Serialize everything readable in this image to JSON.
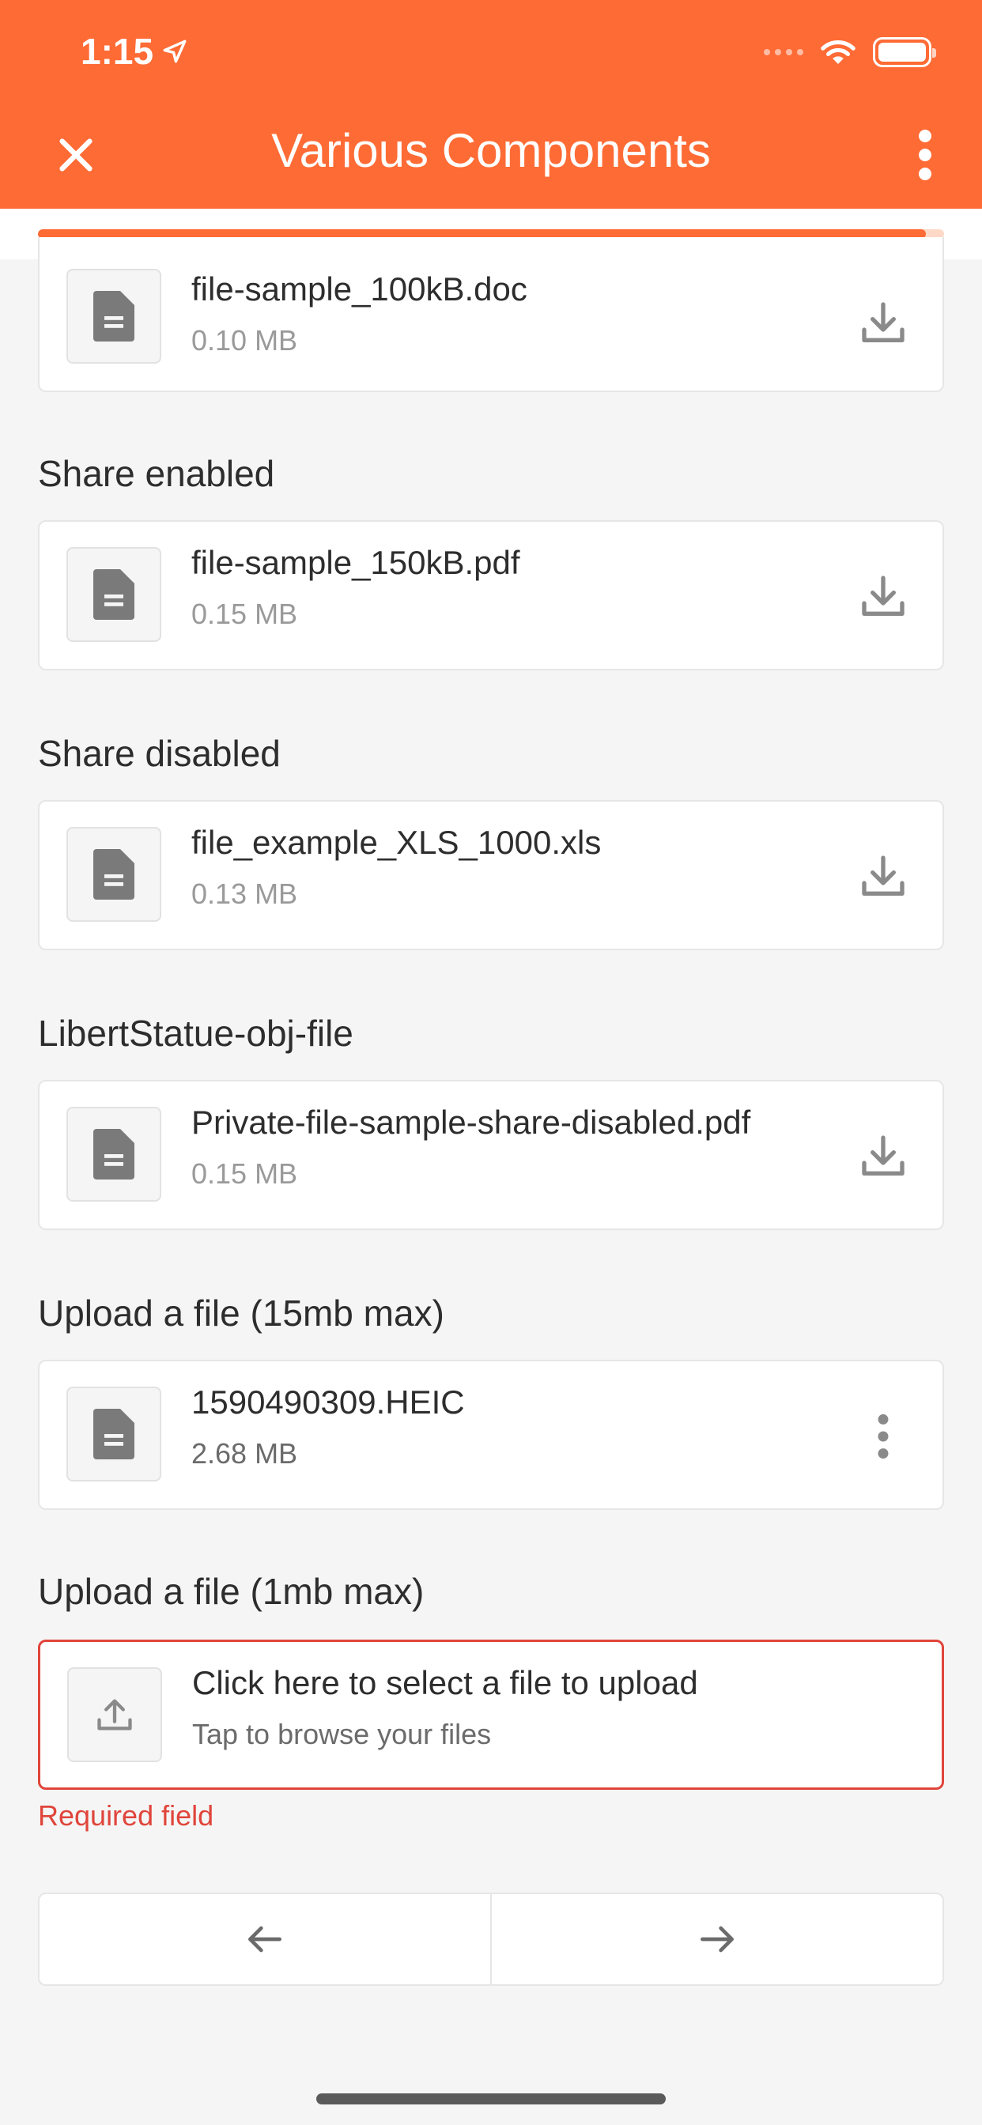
{
  "status_bar": {
    "time": "1:15"
  },
  "header": {
    "title": "Various Components"
  },
  "progress": {
    "fraction": 0.98
  },
  "sections": [
    {
      "label": "",
      "file_name": "file-sample_100kB.doc",
      "file_size": "0.10 MB",
      "action": "download-icon"
    },
    {
      "label": "Share enabled",
      "file_name": "file-sample_150kB.pdf",
      "file_size": "0.15 MB",
      "action": "download-icon"
    },
    {
      "label": "Share disabled",
      "file_name": "file_example_XLS_1000.xls",
      "file_size": "0.13 MB",
      "action": "download-icon"
    },
    {
      "label": "LibertStatue-obj-file",
      "file_name": "Private-file-sample-share-disabled.pdf",
      "file_size": "0.15 MB",
      "action": "download-icon"
    },
    {
      "label": "Upload a file (15mb max)",
      "file_name": "1590490309.HEIC",
      "file_size": "2.68 MB",
      "action": "more-vertical-icon"
    },
    {
      "label": "Upload a file (1mb max)",
      "file_name": "Click here to select a file to upload",
      "file_size": "Tap to browse your files",
      "action": ""
    }
  ],
  "validation": {
    "error_text": "Required field"
  },
  "colors": {
    "accent": "#ff6b35",
    "error": "#e0453b"
  }
}
